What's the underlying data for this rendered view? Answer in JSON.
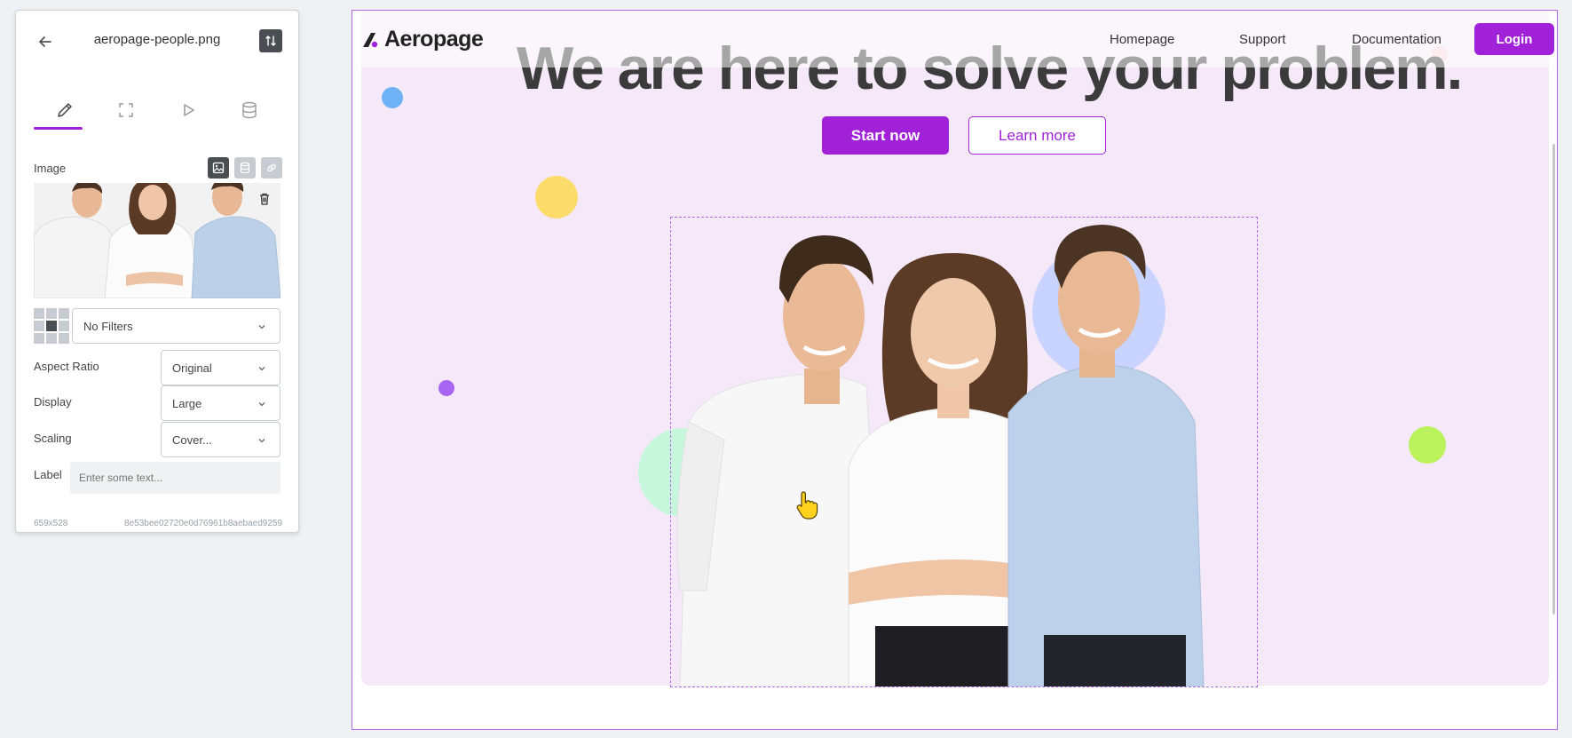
{
  "panel": {
    "file_name": "aeropage-people.png",
    "tabs": [
      {
        "name": "edit",
        "icon": "pencil-icon",
        "active": true
      },
      {
        "name": "fullscreen",
        "icon": "expand-icon",
        "active": false
      },
      {
        "name": "play",
        "icon": "play-icon",
        "active": false
      },
      {
        "name": "database",
        "icon": "database-icon",
        "active": false
      }
    ],
    "image_label": "Image",
    "filter_value": "No Filters",
    "aspect_ratio": {
      "label": "Aspect Ratio",
      "value": "Original"
    },
    "display": {
      "label": "Display",
      "value": "Large"
    },
    "scaling": {
      "label": "Scaling",
      "value": "Cover..."
    },
    "label_field": {
      "label": "Label",
      "placeholder": "Enter some text..."
    },
    "dimensions": "659x528",
    "file_hash": "8e53bee02720e0d76961b8aebaed9259"
  },
  "site": {
    "brand": "Aeropage",
    "nav": [
      "Homepage",
      "Support",
      "Documentation"
    ],
    "login_label": "Login",
    "headline": "We are here to solve your problem.",
    "start_label": "Start now",
    "learn_label": "Learn more"
  },
  "colors": {
    "accent": "#a021d8",
    "hero_bg": "#f5e8f8",
    "dot_blue": "#6fb1f5",
    "dot_yellow": "#fbdc6b",
    "dot_purple": "#a865f2",
    "dot_green": "#b9f25b",
    "dot_mint": "#c6f7dc",
    "dot_periwinkle": "#c9d3ff",
    "dot_pink": "#f9d4dc"
  }
}
